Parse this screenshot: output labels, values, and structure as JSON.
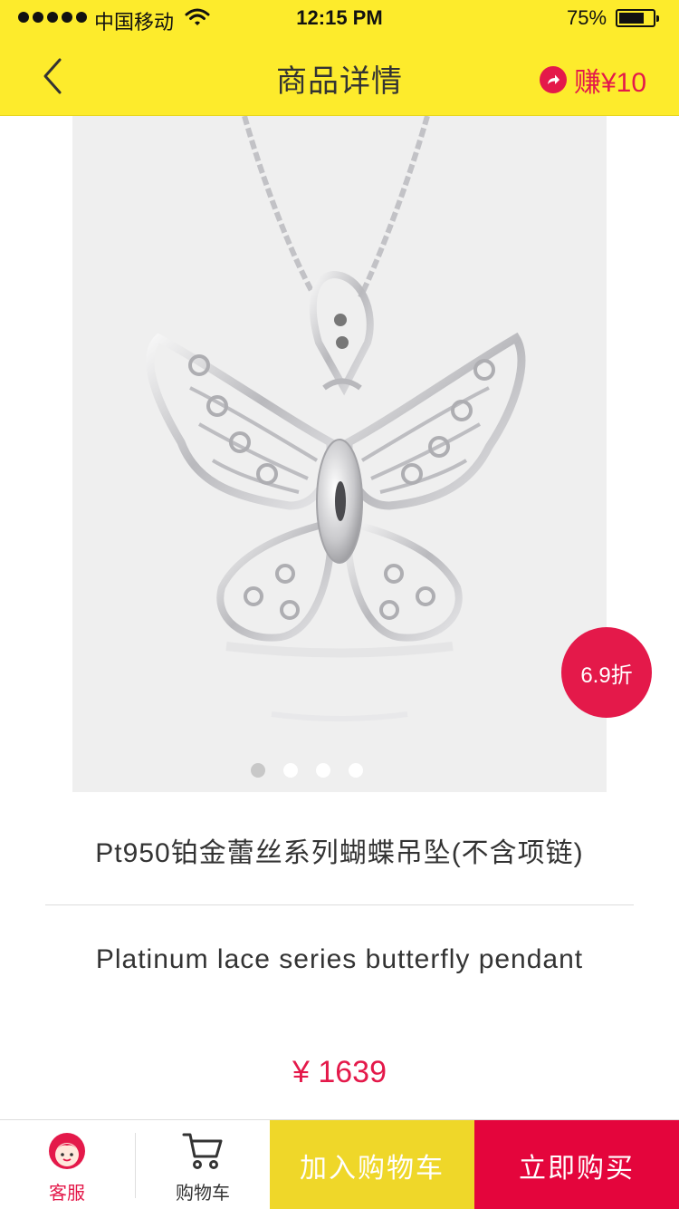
{
  "status_bar": {
    "carrier": "中国移动",
    "time": "12:15 PM",
    "battery": "75%",
    "battery_level": 0.75
  },
  "nav": {
    "title": "商品详情",
    "back_icon": "chevron-left-icon",
    "earn_icon": "share-arrow-icon",
    "earn_label": "赚¥10"
  },
  "gallery": {
    "image": "butterfly-pendant",
    "page_count": 4,
    "active_index": 0,
    "discount": "6.9折"
  },
  "product": {
    "name": "Pt950铂金蕾丝系列蝴蝶吊坠(不含项链)",
    "name_en": "Platinum lace series butterfly pendant",
    "price": "¥ 1639"
  },
  "bottom_bar": {
    "service_label": "客服",
    "service_icon": "customer-service-avatar-icon",
    "cart_label": "购物车",
    "cart_icon": "shopping-cart-icon",
    "add_to_cart": "加入购物车",
    "buy_now": "立即购买"
  },
  "colors": {
    "header_yellow": "#fdeb2c",
    "accent_red": "#e4194a",
    "add_cart_yellow": "#efd729",
    "buy_red": "#e4053c"
  }
}
